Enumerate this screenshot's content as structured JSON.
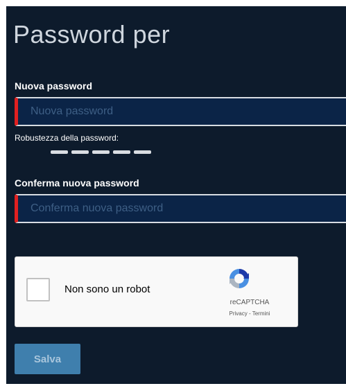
{
  "page": {
    "title": "Password per"
  },
  "new_password": {
    "label": "Nuova password",
    "placeholder": "Nuova password",
    "value": ""
  },
  "strength": {
    "label": "Robustezza della password:",
    "level": 0,
    "segments": 5
  },
  "confirm_password": {
    "label": "Conferma nuova password",
    "placeholder": "Conferma nuova password",
    "value": ""
  },
  "captcha": {
    "checkbox_label": "Non sono un robot",
    "checked": false,
    "brand": "reCAPTCHA",
    "privacy_link": "Privacy",
    "separator": " - ",
    "terms_link": "Termini"
  },
  "actions": {
    "save_label": "Salva"
  },
  "colors": {
    "panel_background": "#0d1b2c",
    "field_background": "#0b2447",
    "field_accent": "#e02020",
    "button_background": "#3f7fad"
  }
}
